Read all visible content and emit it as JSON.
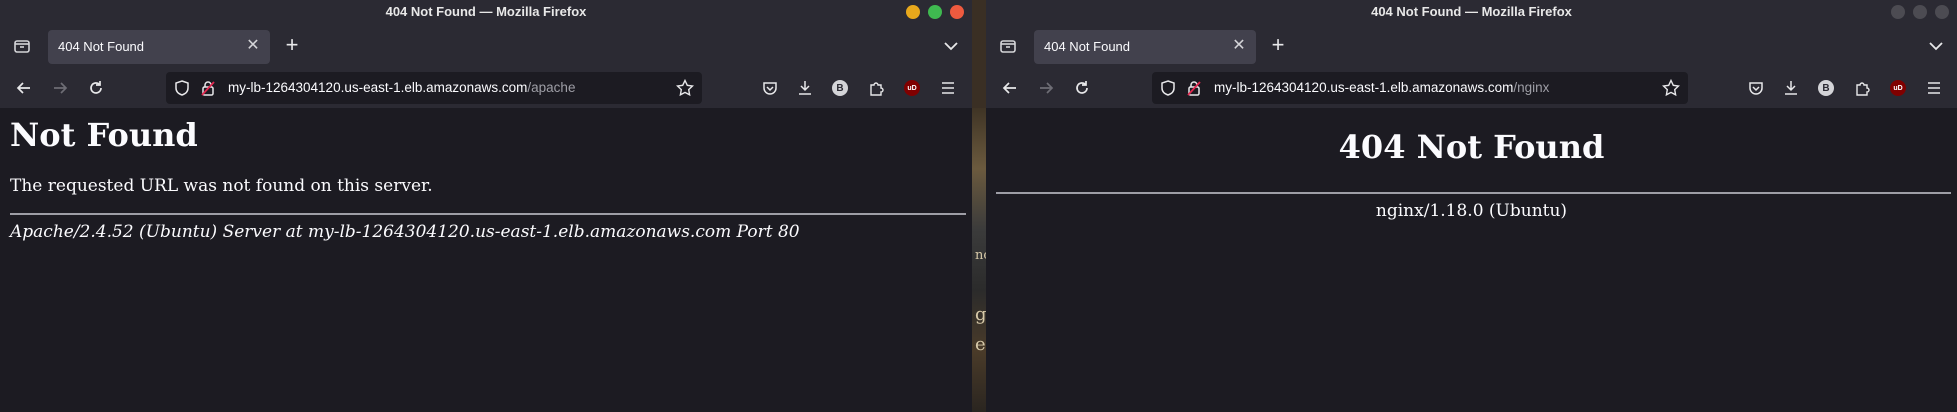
{
  "background_fragments": [
    "nc",
    "g",
    "e"
  ],
  "colors": {
    "close": "#ee5a3f",
    "minimize": "#e8a81c",
    "maximize": "#3fb950",
    "inactive_control": "#4c4b52",
    "ublock": "#800000",
    "avatar": "#d4d4d8"
  },
  "left_window": {
    "title": "404 Not Found — Mozilla Firefox",
    "tab": {
      "title": "404 Not Found"
    },
    "url": {
      "host": "my-lb-1264304120.us-east-1.elb.amazonaws.com",
      "path": "/apache"
    },
    "toolbar": {
      "account_initial": "B",
      "ublock_label": "uD"
    },
    "page": {
      "heading": "Not Found",
      "message": "The requested URL was not found on this server.",
      "address": "Apache/2.4.52 (Ubuntu) Server at my-lb-1264304120.us-east-1.elb.amazonaws.com Port 80"
    }
  },
  "right_window": {
    "title": "404 Not Found — Mozilla Firefox",
    "tab": {
      "title": "404 Not Found"
    },
    "url": {
      "host": "my-lb-1264304120.us-east-1.elb.amazonaws.com",
      "path": "/nginx"
    },
    "toolbar": {
      "account_initial": "B",
      "ublock_label": "uD"
    },
    "page": {
      "heading": "404 Not Found",
      "server": "nginx/1.18.0 (Ubuntu)"
    }
  }
}
